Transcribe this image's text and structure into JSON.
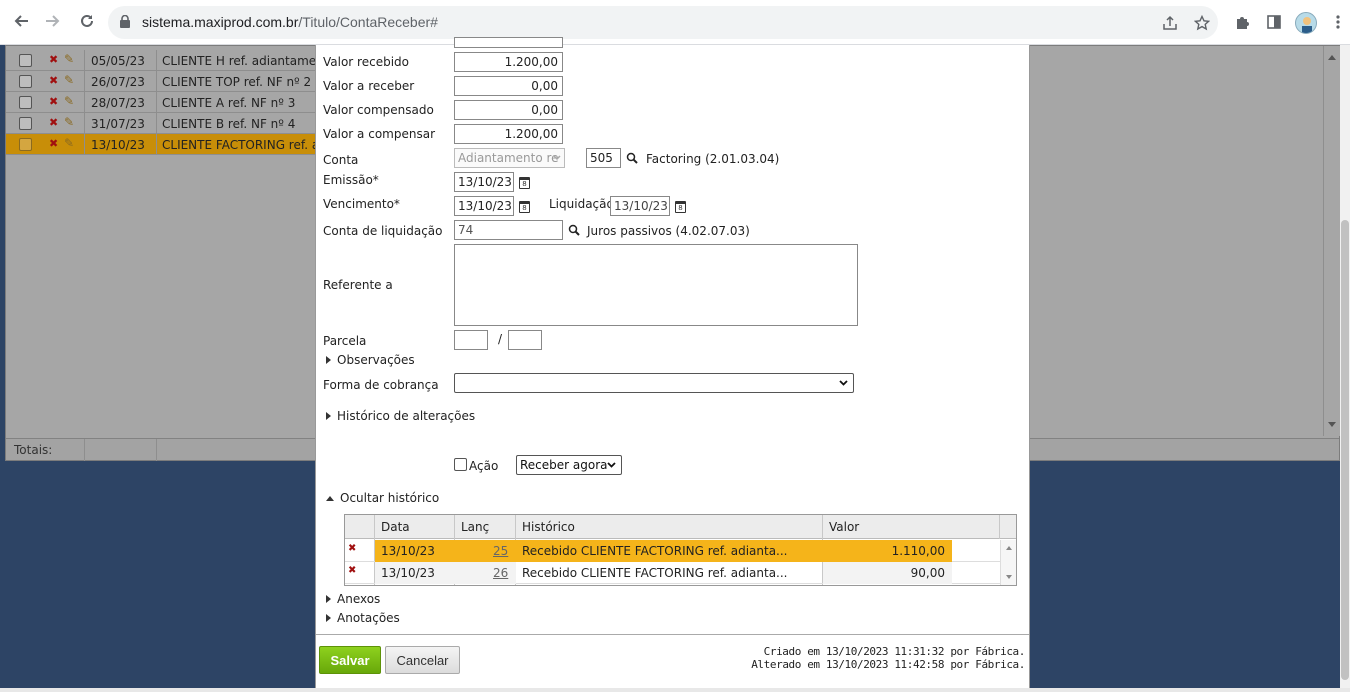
{
  "browser": {
    "url_host": "sistema.maxiprod.com.br",
    "url_path": "/Titulo/ContaReceber#"
  },
  "bg_grid": {
    "rows": [
      {
        "date": "05/05/23",
        "desc": "CLIENTE H ref. adiantamento"
      },
      {
        "date": "26/07/23",
        "desc": "CLIENTE TOP ref. NF nº 2"
      },
      {
        "date": "28/07/23",
        "desc": "CLIENTE A ref. NF nº 3"
      },
      {
        "date": "31/07/23",
        "desc": "CLIENTE B ref. NF nº 4"
      },
      {
        "date": "13/10/23",
        "desc": "CLIENTE FACTORING ref. adiantamento"
      }
    ],
    "totals_label": "Totais:"
  },
  "form": {
    "valor_recebido_label": "Valor recebido",
    "valor_recebido": "1.200,00",
    "valor_a_receber_label": "Valor a receber",
    "valor_a_receber": "0,00",
    "valor_compensado_label": "Valor compensado",
    "valor_compensado": "0,00",
    "valor_a_compensar_label": "Valor a compensar",
    "valor_a_compensar": "1.200,00",
    "conta_label": "Conta",
    "conta_select": "Adiantamento re",
    "conta_code": "505",
    "conta_name": "Factoring (2.01.03.04)",
    "emissao_label": "Emissão*",
    "emissao": "13/10/23",
    "vencimento_label": "Vencimento*",
    "vencimento": "13/10/23",
    "liquidacao_label": "Liquidação",
    "liquidacao": "13/10/23",
    "conta_liq_label": "Conta de liquidação",
    "conta_liq_code": "74",
    "conta_liq_name": "Juros passivos (4.02.07.03)",
    "referente_label": "Referente a",
    "referente": "",
    "parcela_label": "Parcela",
    "parcela_sep": "/",
    "observacoes": "Observações",
    "forma_cobranca_label": "Forma de cobrança",
    "forma_cobranca": "",
    "historico_alteracoes": "Histórico de alterações",
    "acao_label": "Ação",
    "acao_option": "Receber agora",
    "ocultar_historico": "Ocultar histórico",
    "anexos": "Anexos",
    "anotacoes": "Anotações"
  },
  "history": {
    "columns": [
      "Data",
      "Lanç",
      "Histórico",
      "Valor"
    ],
    "rows": [
      {
        "data": "13/10/23",
        "lanc": "25",
        "historico": "Recebido CLIENTE FACTORING ref. adianta...",
        "valor": "1.110,00"
      },
      {
        "data": "13/10/23",
        "lanc": "26",
        "historico": "Recebido CLIENTE FACTORING ref. adianta...",
        "valor": "90,00"
      }
    ]
  },
  "footer": {
    "save_label": "Salvar",
    "cancel_label": "Cancelar",
    "criado": "Criado em 13/10/2023 11:31:32 por Fábrica.",
    "alterado": "Alterado em 13/10/2023 11:42:58 por Fábrica."
  },
  "colors": {
    "selected_row": "#f5b41a",
    "save_button": "#7cc012",
    "overlay_bg": "#2d4465"
  }
}
